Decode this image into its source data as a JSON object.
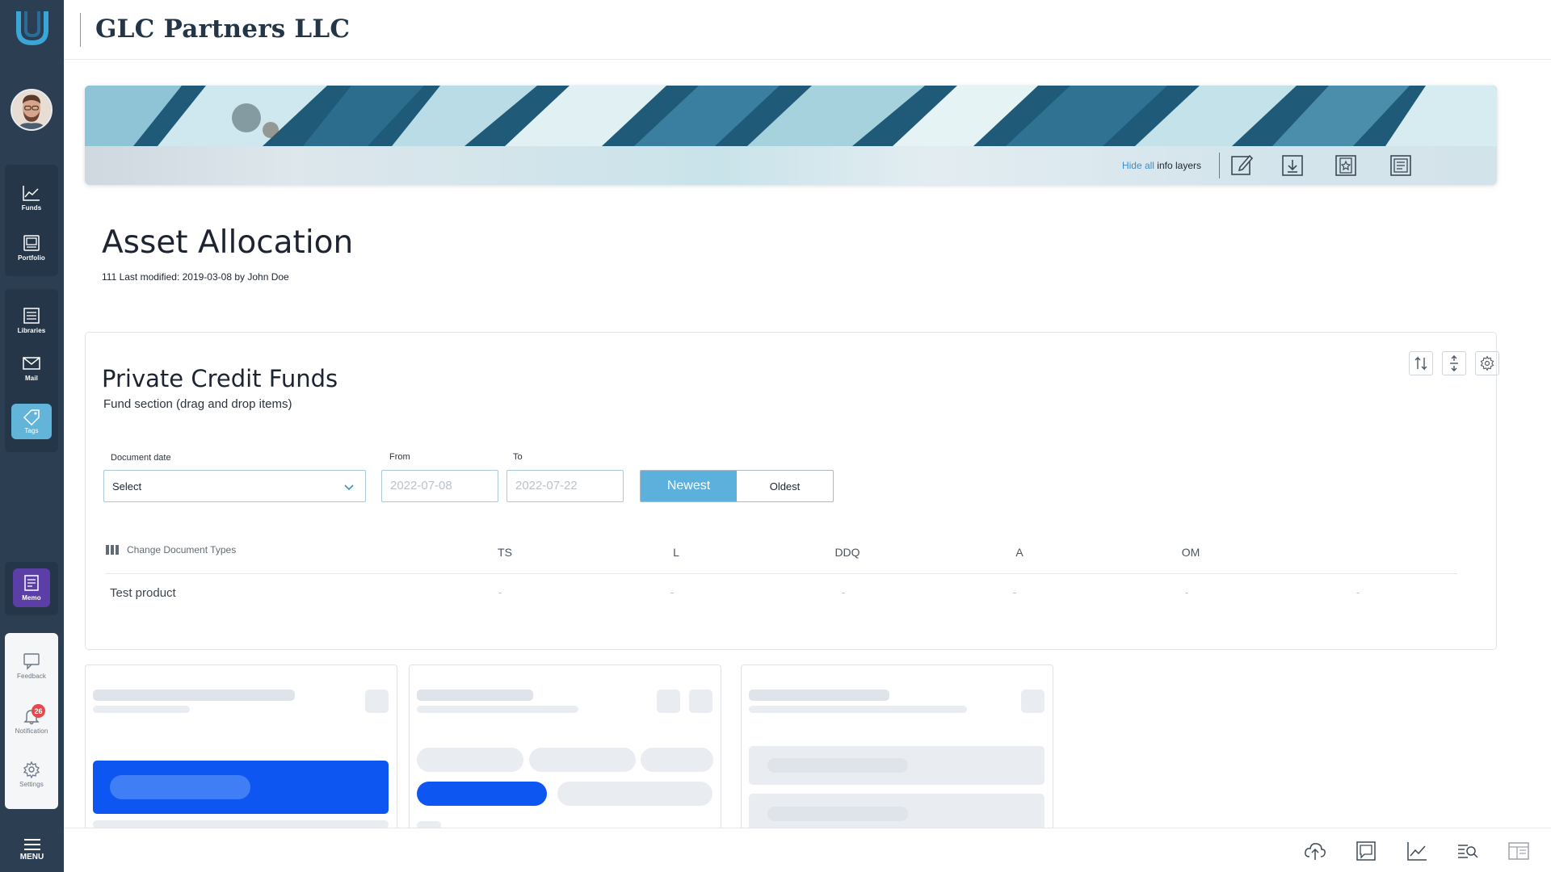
{
  "app": {
    "company_title": "GLC Partners LLC"
  },
  "sidebar": {
    "items": [
      {
        "label": "Funds",
        "icon": "chart-line-icon"
      },
      {
        "label": "Portfolio",
        "icon": "portfolio-icon"
      },
      {
        "label": "Libraries",
        "icon": "list-icon"
      },
      {
        "label": "Mail",
        "icon": "mail-icon"
      },
      {
        "label": "Tags",
        "icon": "tag-icon"
      },
      {
        "label": "Memo",
        "icon": "memo-icon"
      }
    ],
    "bottom_items": [
      {
        "label": "Feedback",
        "icon": "feedback-icon"
      },
      {
        "label": "Notification",
        "icon": "bell-icon",
        "badge": "26"
      },
      {
        "label": "Settings",
        "icon": "gear-icon"
      }
    ],
    "menu_label": "MENU",
    "colors": {
      "sidebar_bg": "#2c3e51",
      "tags_active": "#62b5d8",
      "memo_active": "#5b3fa6"
    }
  },
  "banner": {
    "hide_link": "Hide all",
    "hide_rest": " info layers",
    "icons": [
      "edit-icon",
      "download-icon",
      "star-doc-icon",
      "document-list-icon"
    ]
  },
  "page": {
    "title": "Asset Allocation",
    "meta": "111 Last modified: 2019-03-08 by John Doe"
  },
  "fund_section": {
    "title": "Private Credit Funds",
    "subtitle": "Fund section (drag and drop items)",
    "tools": [
      "sort-icon",
      "expand-icon",
      "gear-icon"
    ],
    "filters": {
      "document_date_label": "Document date",
      "document_date_value": "Select",
      "from_label": "From",
      "from_placeholder": "2022-07-08",
      "to_label": "To",
      "to_placeholder": "2022-07-22",
      "sort_options": [
        "Newest",
        "Oldest"
      ],
      "sort_selected": "Newest"
    },
    "table": {
      "change_types_label": "Change Document Types",
      "columns": [
        "TS",
        "L",
        "DDQ",
        "A",
        "OM"
      ],
      "rows": [
        {
          "name": "Test product",
          "values": [
            "-",
            "-",
            "-",
            "-",
            "-",
            "-"
          ]
        }
      ]
    }
  },
  "bottombar": {
    "icons": [
      "cloud-upload-icon",
      "chat-box-icon",
      "chart-line-icon",
      "search-list-icon",
      "panel-icon"
    ]
  }
}
